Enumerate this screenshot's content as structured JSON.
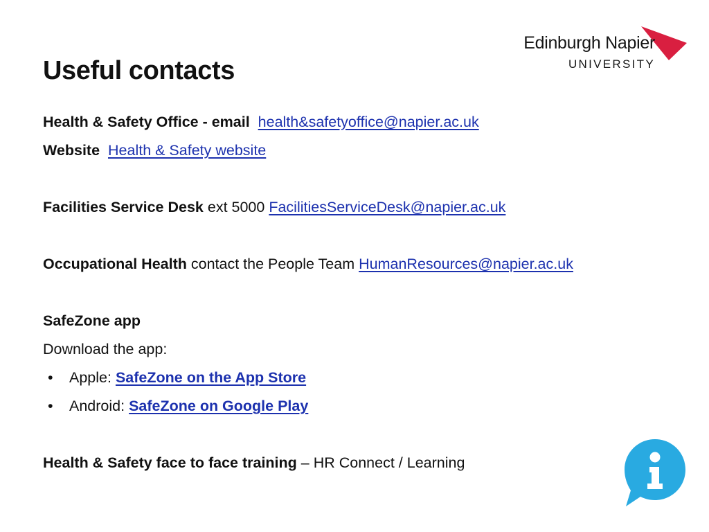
{
  "slide": {
    "title": "Useful contacts",
    "background_color": "#ffffff"
  },
  "logo": {
    "wordmark": "Edinburgh Napier",
    "subtitle": "UNIVERSITY",
    "swoosh_color": "#d91f40",
    "text_color": "#161616"
  },
  "colors": {
    "link_blue": "#1c31ae",
    "info_icon_blue": "#29aae1",
    "text_black": "#111111"
  },
  "contacts": {
    "health_safety": {
      "label": "Health & Safety Office - email",
      "email": "health&safetyoffice@napier.ac.uk",
      "website_label": "Website",
      "website_link": "Health & Safety website"
    },
    "facilities": {
      "label": "Facilities Service Desk",
      "extension": "ext 5000",
      "email": "FacilitiesServiceDesk@napier.ac.uk"
    },
    "occupational_health": {
      "label": "Occupational Health",
      "note": "contact the People Team",
      "email": "HumanResources@napier.ac.uk"
    },
    "safezone": {
      "heading": "SafeZone app",
      "instruction": "Download the app:",
      "bullet_glyph": "•",
      "items": [
        {
          "platform": "Apple:",
          "link": "SafeZone on the App Store"
        },
        {
          "platform": "Android:",
          "link": "SafeZone on Google Play "
        }
      ]
    },
    "training": {
      "label": "Health & Safety face to face training",
      "detail": "– HR Connect / Learning"
    }
  },
  "icons": {
    "info": "info-speech-bubble-icon"
  }
}
